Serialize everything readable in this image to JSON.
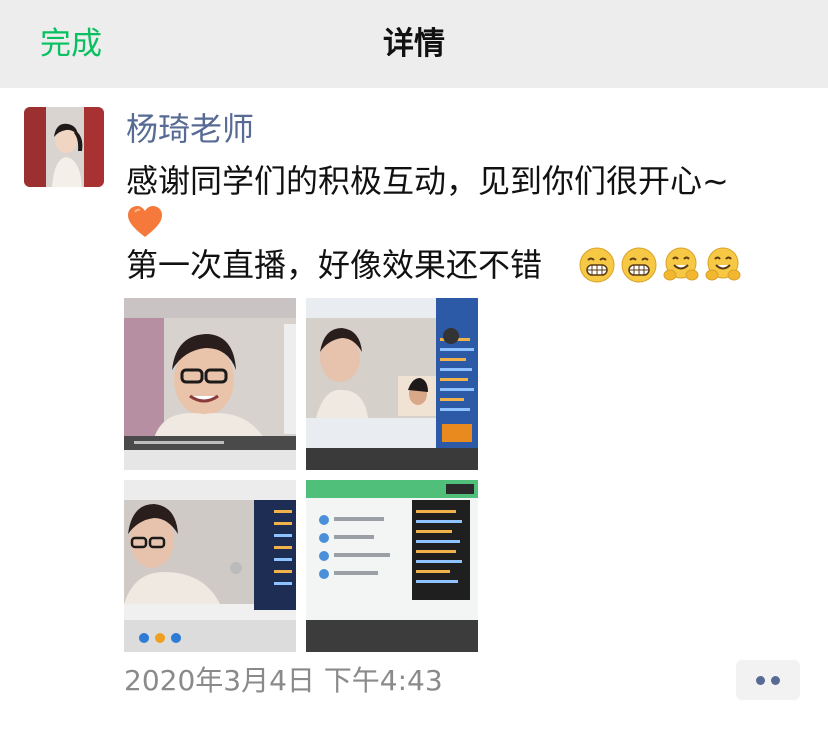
{
  "navbar": {
    "done_label": "完成",
    "title": "详情"
  },
  "post": {
    "author": "杨琦老师",
    "line1": "感谢同学们的积极互动，见到你们很开心~",
    "line3": "第一次直播，好像效果还不错",
    "emojis": [
      "grin-emoji",
      "grin-emoji",
      "hugging-emoji",
      "hugging-emoji"
    ],
    "heart_icon": "heart-icon",
    "photos": [
      "photo-teacher-smiling",
      "photo-live-stream-screen",
      "photo-teacher-screen",
      "photo-chat-screen"
    ],
    "timestamp": "2020年3月4日 下午4:43"
  },
  "colors": {
    "accent_green": "#07c160",
    "author_blue": "#576b95",
    "navbar_bg": "#ededed"
  }
}
